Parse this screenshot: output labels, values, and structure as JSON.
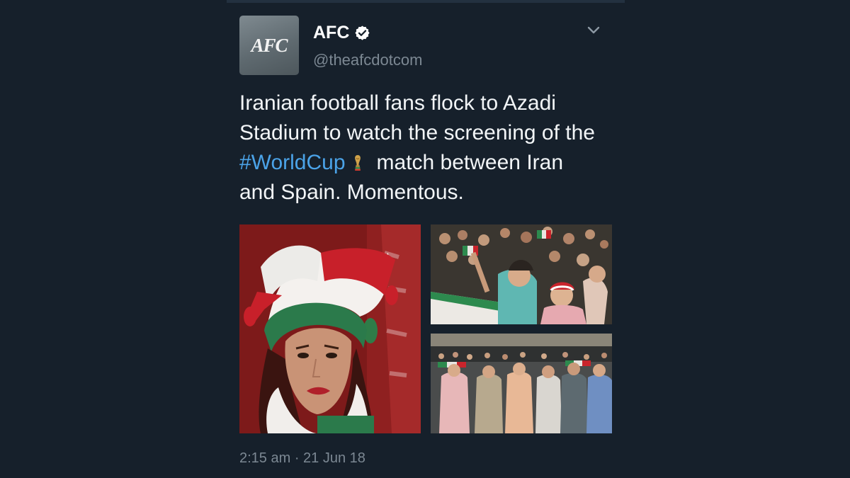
{
  "tweet": {
    "display_name": "AFC",
    "handle": "@theafcdotcom",
    "avatar_text": "AFC",
    "verified": true,
    "text": {
      "line1": "Iranian football fans flock to Azadi",
      "line2": "Stadium to watch the screening of the",
      "hashtag": "#WorldCup",
      "line3_rest": "match between Iran",
      "line4": "and Spain. Momentous."
    },
    "timestamp": "2:15 am · 21 Jun 18",
    "media": [
      {
        "name": "fan-in-jester-hat-photo"
      },
      {
        "name": "cheering-crowd-photo"
      },
      {
        "name": "stadium-stands-photo"
      }
    ]
  },
  "icons": {
    "verified": "verified-badge-icon",
    "menu": "chevron-down-icon",
    "emoji": "world-cup-trophy-icon"
  },
  "colors": {
    "background": "#16202b",
    "hashtag": "#4ba3e8",
    "secondary_text": "#7c8893",
    "primary_text": "#f2f5f7"
  }
}
